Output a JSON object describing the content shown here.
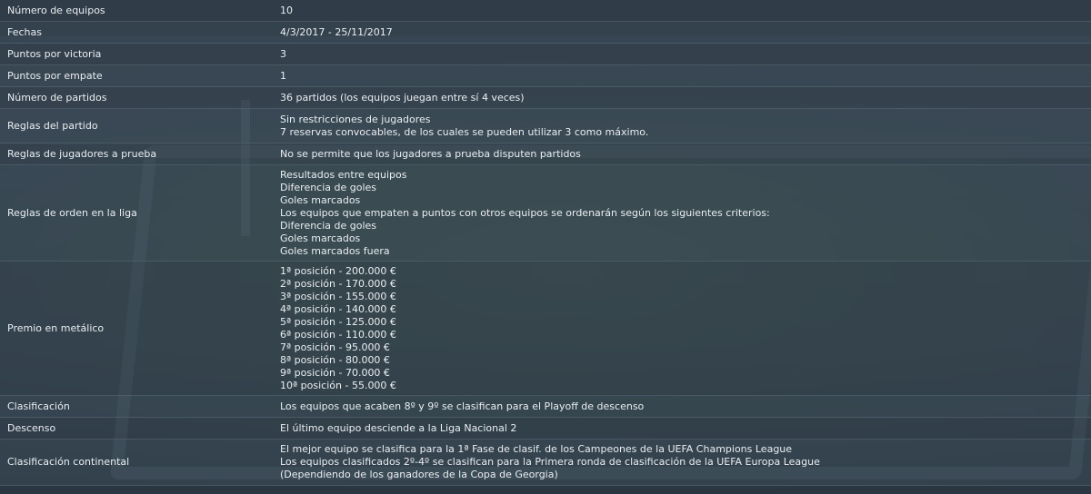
{
  "rows": [
    {
      "label": "Número de equipos",
      "lines": [
        "10"
      ]
    },
    {
      "label": "Fechas",
      "lines": [
        "4/3/2017 - 25/11/2017"
      ]
    },
    {
      "label": "Puntos por victoria",
      "lines": [
        "3"
      ]
    },
    {
      "label": "Puntos por empate",
      "lines": [
        "1"
      ]
    },
    {
      "label": "Número de partidos",
      "lines": [
        "36 partidos (los equipos juegan entre sí 4 veces)"
      ]
    },
    {
      "label": "Reglas del partido",
      "lines": [
        "Sin restricciones de jugadores",
        "7 reservas convocables, de los cuales se pueden utilizar 3 como máximo."
      ]
    },
    {
      "label": "Reglas de jugadores a prueba",
      "lines": [
        "No se permite que los jugadores a prueba disputen partidos"
      ]
    },
    {
      "label": "Reglas de orden en la liga",
      "lines": [
        "Resultados entre equipos",
        "Diferencia de goles",
        "Goles marcados",
        "Los equipos que empaten a puntos con otros equipos se ordenarán según los siguientes criterios:",
        "Diferencia de goles",
        "Goles marcados",
        "Goles marcados fuera"
      ]
    },
    {
      "label": "Premio en metálico",
      "lines": [
        "1ª posición - 200.000 €",
        "2ª posición - 170.000 €",
        "3ª posición - 155.000 €",
        "4ª posición - 140.000 €",
        "5ª posición - 125.000 €",
        "6ª posición - 110.000 €",
        "7ª posición - 95.000 €",
        "8ª posición - 80.000 €",
        "9ª posición - 70.000 €",
        "10ª posición - 55.000 €"
      ]
    },
    {
      "label": "Clasificación",
      "lines": [
        "Los equipos que acaben 8º y 9º se clasifican para el Playoff de descenso"
      ]
    },
    {
      "label": "Descenso",
      "lines": [
        "El último equipo desciende a la Liga Nacional 2"
      ]
    },
    {
      "label": "Clasificación continental",
      "lines": [
        "El mejor equipo se clasifica para la 1ª Fase de clasif. de los Campeones de la UEFA Champions League",
        "Los equipos clasificados 2º-4º se clasifican para la Primera ronda de clasificación de la UEFA Europa League",
        "(Dependiendo de los ganadores de la Copa de Georgia)"
      ]
    }
  ]
}
